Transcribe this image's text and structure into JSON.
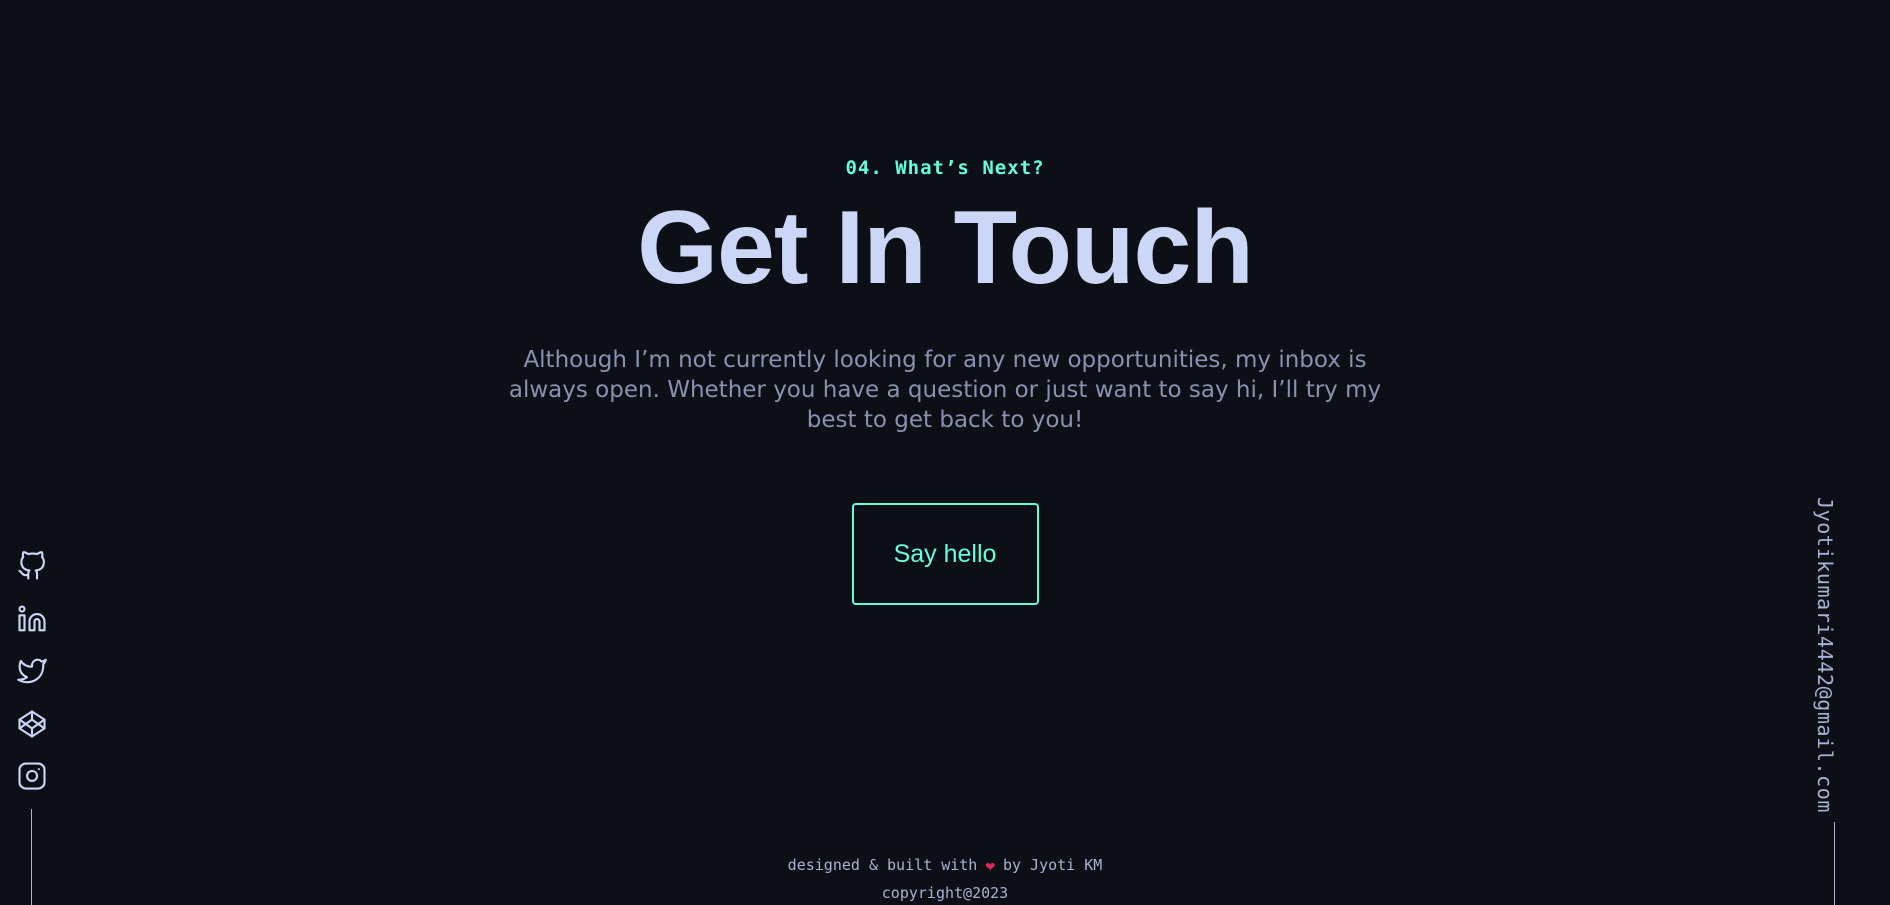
{
  "contact": {
    "overline": "04. What’s Next?",
    "title": "Get In Touch",
    "blurb": "Although I’m not currently looking for any new opportunities, my inbox is always open. Whether you have a question or just want to say hi, I’ll try my best to get back to you!",
    "cta_label": "Say hello"
  },
  "social": {
    "icons": [
      "github-icon",
      "linkedin-icon",
      "twitter-icon",
      "codepen-icon",
      "instagram-icon"
    ]
  },
  "email": "Jyotikumari4442@gmail.com",
  "footer": {
    "designed_prefix": "designed & built with",
    "heart": "❤",
    "designed_suffix": "by Jyoti KM",
    "copyright": "copyright@2023"
  },
  "colors": {
    "background": "#0c1016",
    "accent": "#64ffda",
    "heading": "#ccd6f6",
    "body_text": "#8892b0",
    "light_slate": "#a8b2d1",
    "heart": "#e0245e"
  }
}
